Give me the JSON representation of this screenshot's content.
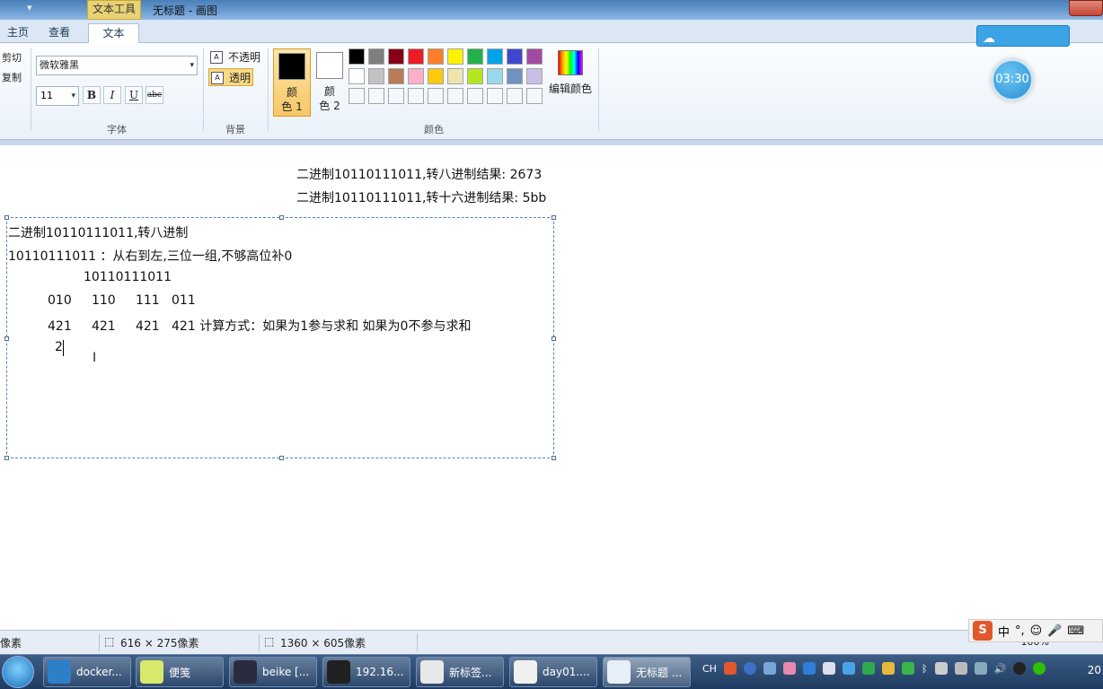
{
  "window": {
    "title": "无标题 - 画图",
    "context_tab": "文本工具"
  },
  "tabs": [
    "主页",
    "查看",
    "文本"
  ],
  "clipboard": {
    "cut": "剪切",
    "copy": "复制"
  },
  "font": {
    "family": "微软雅黑",
    "size": "11",
    "bold": "B",
    "italic": "I",
    "underline": "U",
    "strike": "abc",
    "group_label": "字体"
  },
  "background": {
    "opaque": "不透明",
    "transparent": "透明",
    "group_label": "背景"
  },
  "colors": {
    "color1_label": "颜\n色 1",
    "color2_label": "颜\n色 2",
    "color1_value": "#000000",
    "color2_value": "#ffffff",
    "edit_label": "编辑颜色",
    "group_label": "颜色",
    "palette_row1": [
      "#000000",
      "#7f7f7f",
      "#880015",
      "#ed1c24",
      "#ff7f27",
      "#fff200",
      "#22b14c",
      "#00a2e8",
      "#3f48cc",
      "#a349a4"
    ],
    "palette_row2": [
      "#ffffff",
      "#c3c3c3",
      "#b97a57",
      "#ffaec9",
      "#ffc90e",
      "#efe4b0",
      "#b5e61d",
      "#99d9ea",
      "#7092be",
      "#c8bfe7"
    ]
  },
  "widgets": {
    "timer": "03:30"
  },
  "canvas": {
    "top_line1": "二进制10110111011,转八进制结果: 2673",
    "top_line2": "二进制10110111011,转十六进制结果: 5bb",
    "box_lines": [
      "二进制10110111011,转八进制",
      "10110111011 ：从右到左,三位一组,不够高位补0",
      "10110111011",
      "010     110     111   011",
      "421     421     421   421 计算方式：如果为1参与求和 如果为0不参与求和",
      "2"
    ]
  },
  "status": {
    "pixels_label": "像素",
    "selection_size": "616 × 275像素",
    "canvas_size": "1360 × 605像素",
    "zoom": "100%"
  },
  "ime": {
    "lang": "中"
  },
  "taskbar": {
    "items": [
      {
        "label": "docker...",
        "icon_color": "#2d7fc8"
      },
      {
        "label": "便笺",
        "icon_color": "#d8e86a"
      },
      {
        "label": "beike [...",
        "icon_color": "#2b2b40"
      },
      {
        "label": "192.16...",
        "icon_color": "#202020"
      },
      {
        "label": "新标签...",
        "icon_color": "#e8e8e8"
      },
      {
        "label": "day01....",
        "icon_color": "#f0f0f0"
      },
      {
        "label": "无标题 ...",
        "icon_color": "#e6eef8"
      }
    ],
    "tray_lang": "CH",
    "clock": "20"
  }
}
